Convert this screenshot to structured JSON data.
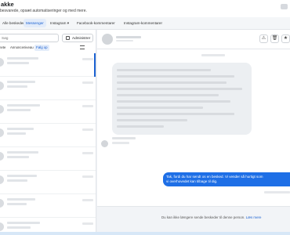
{
  "header": {
    "title": "akke",
    "subtitle": "besvarede, opsæt automatiseringer og med mere."
  },
  "tabs": [
    {
      "label": "Alle beskeder",
      "active": false
    },
    {
      "label": "Messenger",
      "active": true
    },
    {
      "label": "Instagram",
      "active": false,
      "has_dropdown": true
    },
    {
      "label": "Facebook-kommentarer",
      "active": false
    },
    {
      "label": "Instagram-kommentarer",
      "active": false
    }
  ],
  "inbox": {
    "search_placeholder": "Søg",
    "admin_button": "Administrer",
    "filters": [
      "nete",
      "Annonceniveau",
      "Følg op"
    ],
    "active_filter": "Følg op"
  },
  "chat": {
    "outgoing_message_line1": "Tak, fordi du har sendt os en besked. Vi vender så hurtigt som",
    "outgoing_message_line2": "vi overhovedet kan tilbage til dig.",
    "footer_text": "Du kan ikke længere sende beskeder til denne person.",
    "footer_link": "Læs mere"
  },
  "icons": {
    "header_buttons": [
      "warning-icon",
      "trash-icon",
      "star-icon"
    ],
    "filter": "filter-lines-icon",
    "admin": "gear-icon"
  },
  "colors": {
    "accent": "#1b61d1",
    "outgoing_bubble": "#1e6fe6",
    "incoming_bubble": "#eceff2"
  }
}
